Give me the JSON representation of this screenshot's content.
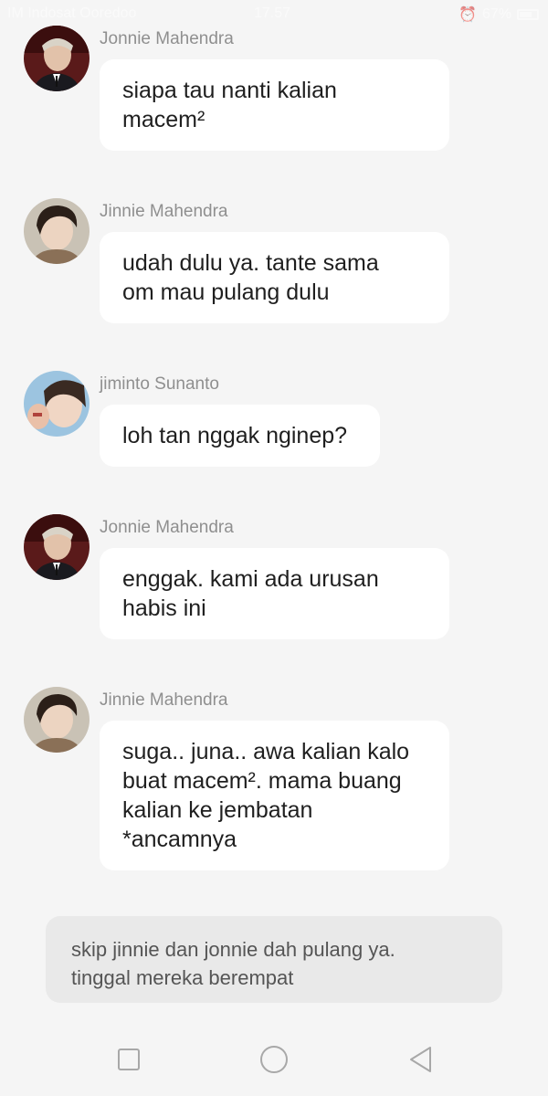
{
  "status_bar": {
    "carrier": "IM Indosat Ooredoo",
    "time": "17.57",
    "battery": "67%"
  },
  "messages": [
    {
      "sender": "Jonnie Mahendra",
      "text": "siapa tau nanti kalian\nmacem²",
      "avatar": "avatar-jonnie"
    },
    {
      "sender": "Jinnie Mahendra",
      "text": "udah dulu ya. tante sama\nom mau pulang dulu",
      "avatar": "avatar-jinnie"
    },
    {
      "sender": "jiminto Sunanto",
      "text": "loh tan nggak nginep?",
      "avatar": "avatar-jiminto"
    },
    {
      "sender": "Jonnie Mahendra",
      "text": "enggak. kami ada urusan\nhabis ini",
      "avatar": "avatar-jonnie"
    },
    {
      "sender": "Jinnie Mahendra",
      "text": "suga.. juna.. awa kalian kalo\nbuat macem². mama buang\nkalian ke jembatan\n*ancamnya",
      "avatar": "avatar-jinnie"
    }
  ],
  "narration": "skip jinnie dan jonnie dah pulang ya.\ntinggal mereka berempat",
  "nav_icons": [
    "recent-apps-icon",
    "home-icon",
    "back-icon"
  ]
}
